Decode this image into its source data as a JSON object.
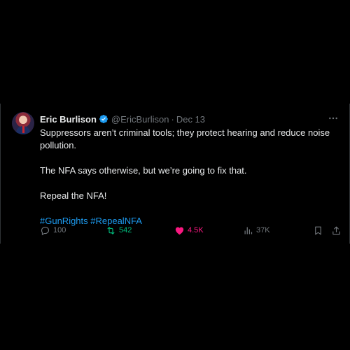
{
  "tweet": {
    "author_name": "Eric Burlison",
    "handle": "@EricBurlison",
    "separator": "·",
    "date": "Dec 13",
    "text_line1": "Suppressors aren’t criminal tools; they protect hearing and reduce noise pollution.",
    "text_line2": "The NFA says otherwise, but we’re going to fix that.",
    "text_line3": "Repeal the NFA!",
    "hashtags": "#GunRights #RepealNFA"
  },
  "metrics": {
    "replies": "100",
    "reposts": "542",
    "likes": "4.5K",
    "views": "37K"
  },
  "colors": {
    "background": "#000000",
    "text": "#e7e9ea",
    "muted": "#71767b",
    "link": "#1d9bf0",
    "repost_active": "#00ba7c",
    "like_active": "#f91880",
    "verified": "#1d9bf0"
  },
  "icons": {
    "verified": "verified-badge-icon",
    "more": "more-icon",
    "reply": "reply-icon",
    "repost": "repost-icon",
    "like": "heart-icon",
    "views": "views-icon",
    "bookmark": "bookmark-icon",
    "share": "share-icon"
  }
}
